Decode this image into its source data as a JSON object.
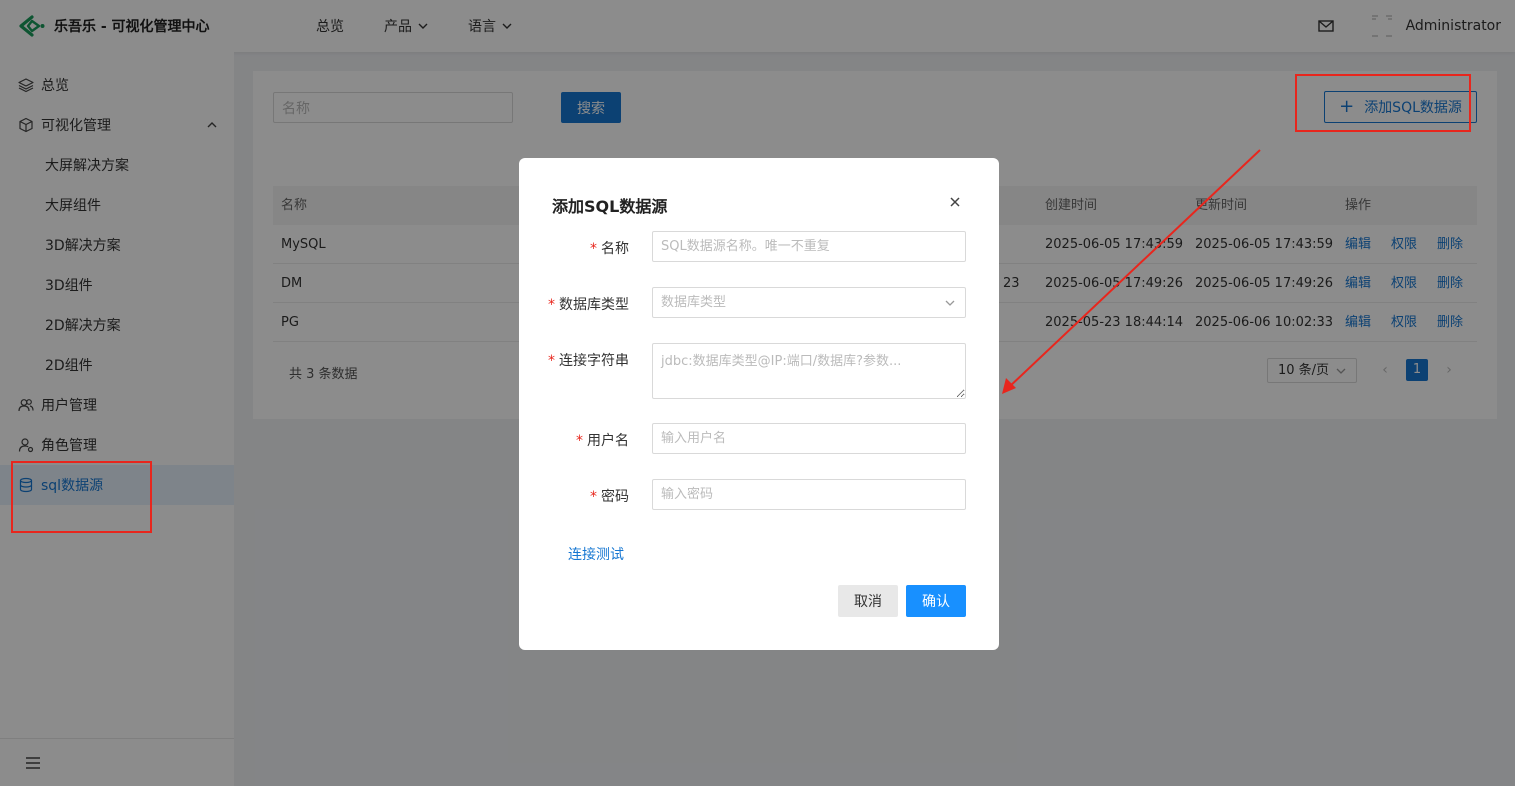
{
  "app": {
    "title": "乐吾乐 - 可视化管理中心"
  },
  "topnav": [
    {
      "label": "总览",
      "has_dropdown": false
    },
    {
      "label": "产品",
      "has_dropdown": true
    },
    {
      "label": "语言",
      "has_dropdown": true
    }
  ],
  "header": {
    "user": "Administrator"
  },
  "sidebar": {
    "items": [
      {
        "label": "总览",
        "icon": "layers-icon"
      },
      {
        "label": "可视化管理",
        "icon": "cube-icon",
        "expanded": true
      },
      {
        "label": "大屏解决方案"
      },
      {
        "label": "大屏组件"
      },
      {
        "label": "3D解决方案"
      },
      {
        "label": "3D组件"
      },
      {
        "label": "2D解决方案"
      },
      {
        "label": "2D组件"
      },
      {
        "label": "用户管理",
        "icon": "users-icon"
      },
      {
        "label": "角色管理",
        "icon": "user-role-icon"
      },
      {
        "label": "sql数据源",
        "icon": "database-icon",
        "active": true
      }
    ]
  },
  "main": {
    "search_placeholder": "名称",
    "search_button": "搜索",
    "add_button": "添加SQL数据源",
    "table": {
      "columns": [
        "名称",
        "创建时间",
        "更新时间",
        "操作"
      ],
      "rows": [
        {
          "name": "MySQL",
          "created": "2025-06-05 17:43:59",
          "updated": "2025-06-05 17:43:59"
        },
        {
          "name": "DM",
          "partial": "23",
          "created": "2025-06-05 17:49:26",
          "updated": "2025-06-05 17:49:26"
        },
        {
          "name": "PG",
          "created": "2025-05-23 18:44:14",
          "updated": "2025-06-06 10:02:33"
        }
      ],
      "actions": [
        "编辑",
        "权限",
        "删除"
      ]
    },
    "pagination": {
      "total_text": "共 3 条数据",
      "page_size": "10 条/页",
      "prev": "‹",
      "next": "›",
      "current_page": "1"
    }
  },
  "modal": {
    "title": "添加SQL数据源",
    "fields": {
      "name": {
        "label": "名称",
        "placeholder": "SQL数据源名称。唯一不重复"
      },
      "db_type": {
        "label": "数据库类型",
        "placeholder": "数据库类型"
      },
      "conn_str": {
        "label": "连接字符串",
        "placeholder": "jdbc:数据库类型@IP:端口/数据库?参数..."
      },
      "username": {
        "label": "用户名",
        "placeholder": "输入用户名"
      },
      "password": {
        "label": "密码",
        "placeholder": "输入密码"
      }
    },
    "test_link": "连接测试",
    "cancel": "取消",
    "confirm": "确认"
  },
  "colors": {
    "accent": "#1677d2",
    "annotation": "#e8261d",
    "required": "#e8261d"
  }
}
